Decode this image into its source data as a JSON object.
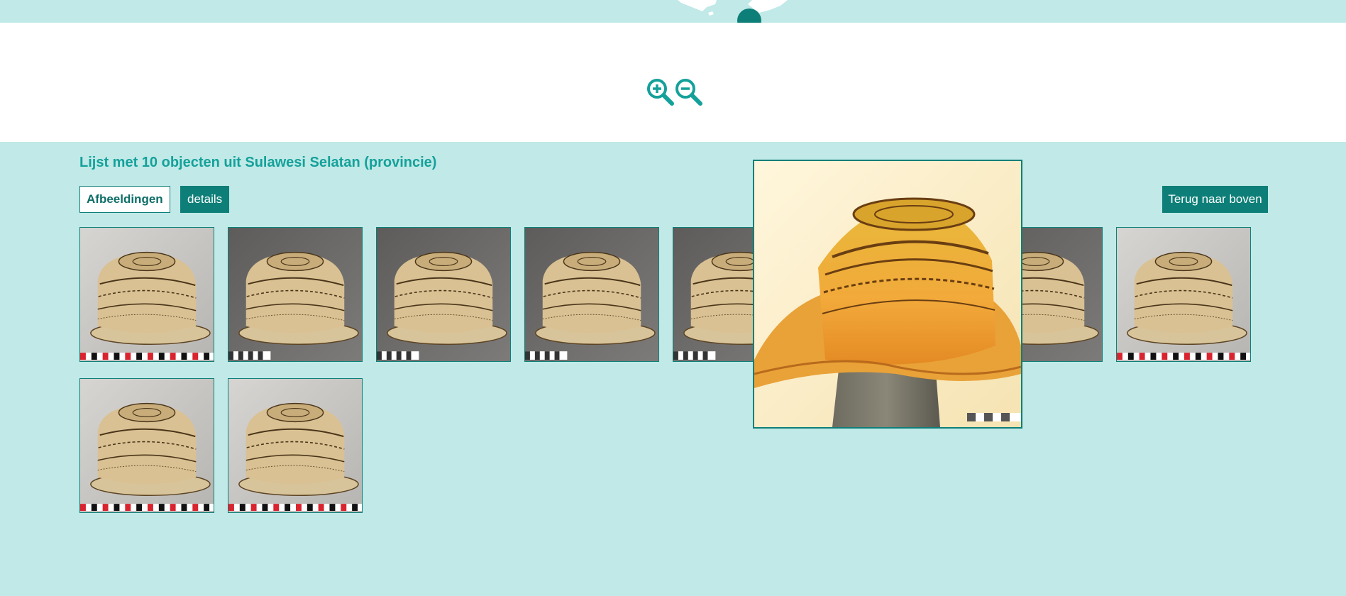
{
  "list": {
    "title": "Lijst met 10 objecten uit Sulawesi Selatan (provincie)"
  },
  "toolbar": {
    "images_label": "Afbeeldingen",
    "details_label": "details",
    "back_to_top_label": "Terug naar boven"
  },
  "map": {
    "zoom_in_icon": "zoom-in-icon",
    "zoom_out_icon": "zoom-out-icon"
  },
  "thumbnails": [
    {
      "icon": "woven-hat-image",
      "background": "light"
    },
    {
      "icon": "woven-hat-image",
      "background": "dark"
    },
    {
      "icon": "woven-hat-image",
      "background": "dark"
    },
    {
      "icon": "woven-hat-image",
      "background": "dark"
    },
    {
      "icon": "woven-hat-image",
      "background": "dark"
    },
    {
      "icon": "woven-hat-image",
      "background": "dark"
    },
    {
      "icon": "woven-hat-image",
      "background": "light"
    },
    {
      "icon": "woven-hat-image",
      "background": "light"
    },
    {
      "icon": "woven-hat-image",
      "background": "light"
    },
    {
      "icon": "woven-hat-image",
      "background": "dark"
    }
  ],
  "preview": {
    "icon": "woven-hat-enlarged-image"
  },
  "colors": {
    "accent": "#0e7f78",
    "title": "#14a19a",
    "background": "#c0e9e7"
  }
}
